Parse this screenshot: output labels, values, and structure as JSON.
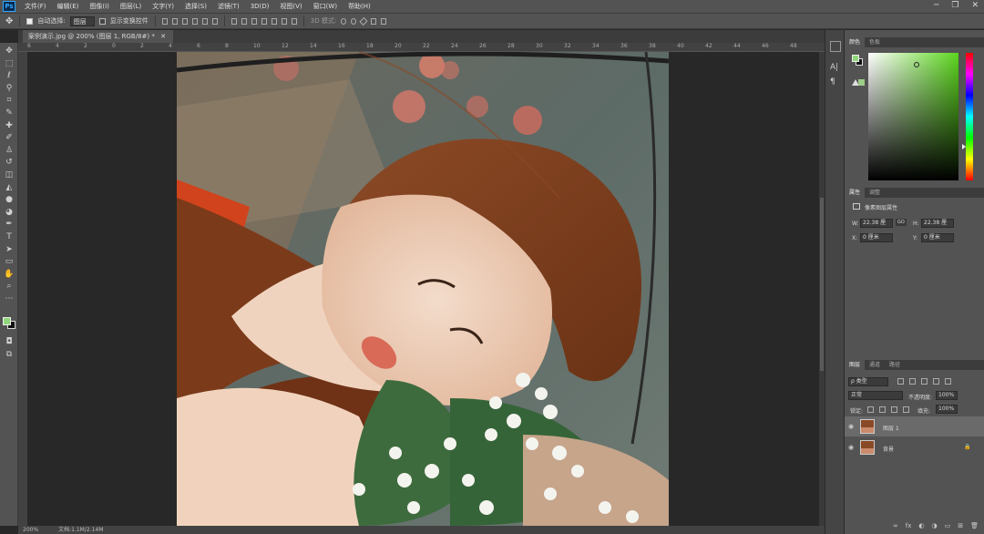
{
  "app": {
    "logo_text": "Ps"
  },
  "menu": [
    "文件(F)",
    "编辑(E)",
    "图像(I)",
    "图层(L)",
    "文字(Y)",
    "选择(S)",
    "滤镜(T)",
    "3D(D)",
    "视图(V)",
    "窗口(W)",
    "帮助(H)"
  ],
  "window_controls": {
    "minimize": "─",
    "restore": "❐",
    "close": "✕"
  },
  "options_bar": {
    "move_icon": "✥",
    "auto_select_label": "自动选择:",
    "auto_select_value": "图层",
    "show_transform_label": "显示变换控件",
    "mode_3d_label": "3D 模式:",
    "right_icons": [
      "⌕",
      "▭",
      "⊡"
    ]
  },
  "document_tab": {
    "title": "案例演示.jpg @ 200% (图层 1, RGB/8#) *",
    "close": "✕"
  },
  "ruler": {
    "labels": [
      "6",
      "4",
      "2",
      "0",
      "2",
      "4",
      "6",
      "8",
      "10",
      "12",
      "14",
      "16",
      "18",
      "20",
      "22",
      "24",
      "26",
      "28",
      "30",
      "32",
      "34",
      "36",
      "38",
      "40",
      "42",
      "44",
      "46",
      "48"
    ]
  },
  "tools": [
    {
      "name": "move-tool-icon",
      "glyph": "✥"
    },
    {
      "name": "marquee-tool-icon",
      "glyph": "⬚"
    },
    {
      "name": "lasso-tool-icon",
      "glyph": "ℓ"
    },
    {
      "name": "quick-select-tool-icon",
      "glyph": "⚲"
    },
    {
      "name": "crop-tool-icon",
      "glyph": "⌗"
    },
    {
      "name": "eyedropper-tool-icon",
      "glyph": "✎"
    },
    {
      "name": "healing-brush-tool-icon",
      "glyph": "✚"
    },
    {
      "name": "brush-tool-icon",
      "glyph": "✐"
    },
    {
      "name": "clone-stamp-tool-icon",
      "glyph": "♙"
    },
    {
      "name": "history-brush-tool-icon",
      "glyph": "↺"
    },
    {
      "name": "eraser-tool-icon",
      "glyph": "◫"
    },
    {
      "name": "paint-bucket-tool-icon",
      "glyph": "◭"
    },
    {
      "name": "blur-tool-icon",
      "glyph": "●"
    },
    {
      "name": "dodge-tool-icon",
      "glyph": "◕"
    },
    {
      "name": "pen-tool-icon",
      "glyph": "✒"
    },
    {
      "name": "type-tool-icon",
      "glyph": "T"
    },
    {
      "name": "path-select-tool-icon",
      "glyph": "➤"
    },
    {
      "name": "rectangle-tool-icon",
      "glyph": "▭"
    },
    {
      "name": "hand-tool-icon",
      "glyph": "✋"
    },
    {
      "name": "zoom-tool-icon",
      "glyph": "⌕"
    },
    {
      "name": "more-tools-icon",
      "glyph": "⋯"
    }
  ],
  "colors": {
    "foreground": "#8fd67b",
    "background": "#111111",
    "accent": "#31a8ff"
  },
  "status": {
    "zoom": "200%",
    "doc": "文档:1.1M/2.14M"
  },
  "color_panel": {
    "tabs": [
      "颜色",
      "色板"
    ]
  },
  "properties_panel": {
    "tabs": [
      "属性",
      "调整"
    ],
    "title": "像素图层属性",
    "w_label": "W:",
    "w_value": "22.38 厘",
    "h_label": "H:",
    "h_value": "22.38 厘",
    "x_label": "X:",
    "x_value": "0 厘米",
    "y_label": "Y:",
    "y_value": "0 厘米",
    "link": "GO"
  },
  "layers_panel": {
    "tabs": [
      "图层",
      "通道",
      "路径"
    ],
    "filter_label": "ρ 类型",
    "blend_mode": "正常",
    "opacity_label": "不透明度:",
    "opacity_value": "100%",
    "lock_label": "锁定:",
    "fill_label": "填充:",
    "fill_value": "100%",
    "layers": [
      {
        "name": "图层 1",
        "selected": true,
        "lock": ""
      },
      {
        "name": "背景",
        "selected": false,
        "lock": "🔒"
      }
    ],
    "bottom_icons": [
      "∞",
      "fx",
      "◐",
      "◑",
      "▭",
      "⊞",
      "🗑"
    ]
  }
}
